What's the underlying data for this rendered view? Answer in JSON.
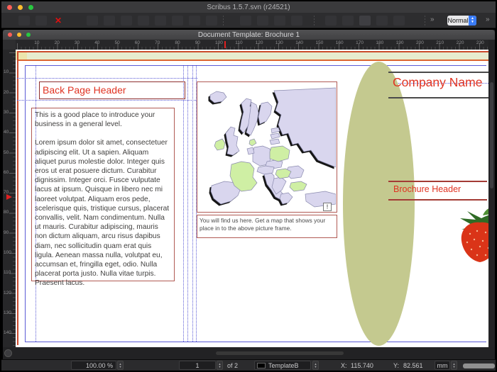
{
  "app": {
    "title": "Scribus 1.5.7.svn (r24521)"
  },
  "toolbar": {
    "close_glyph": "✕",
    "overflow_left": "»",
    "overflow_right": "»",
    "view_mode": "Normal"
  },
  "doc_window": {
    "title": "Document Template: Brochure 1"
  },
  "rulers": {
    "h_numbers": [
      "10",
      "20",
      "30",
      "40",
      "50",
      "60",
      "70",
      "80",
      "90",
      "100",
      "110",
      "120",
      "130",
      "140",
      "150",
      "160",
      "170",
      "180",
      "190",
      "200",
      "210",
      "220",
      "230"
    ],
    "v_numbers": [
      "10",
      "20",
      "30",
      "40",
      "50",
      "60",
      "70",
      "80",
      "90",
      "100",
      "110",
      "120",
      "130",
      "140"
    ]
  },
  "page": {
    "back_page_header": "Back Page Header",
    "body_paragraphs": [
      "This is a good place to introduce your business in a general level.",
      "Lorem ipsum dolor sit amet, consectetuer adipiscing elit. Ut a sapien. Aliquam aliquet purus molestie dolor. Integer quis eros ut erat posuere dictum. Curabitur dignissim. Integer orci. Fusce vulputate lacus at ipsum. Quisque in libero nec mi laoreet volutpat. Aliquam eros pede, scelerisque quis, tristique cursus, placerat convallis, velit. Nam condimentum. Nulla ut mauris. Curabitur adipiscing, mauris non dictum aliquam, arcu risus dapibus diam, nec sollicitudin quam erat quis ligula. Aenean massa nulla, volutpat eu, accumsan et, fringilla eget, odio. Nulla placerat porta justo. Nulla vitae turpis. Praesent lacus."
    ],
    "map_caption": "You will find us here. Get a map that shows your place in to the above picture frame.",
    "image_warning_glyph": "!",
    "company_name": "Company Name",
    "brochure_header": "Brochure Header"
  },
  "statusbar": {
    "zoom": "100.00 %",
    "page_current": "1",
    "page_total_label": "of 2",
    "layer": "TemplateB",
    "x_label": "X:",
    "x_value": "115.740",
    "y_label": "Y:",
    "y_value": "82.561",
    "unit": "mm"
  },
  "colors": {
    "red_heading": "#e03322",
    "frame_border": "#b15a54",
    "guide_blue": "#5c5cd6",
    "page_border_red": "#cc4a2c",
    "surfboard_green": "#c4c98f",
    "map_country": "#d9d6ee",
    "map_highlight": "#cfefa4",
    "strawberry_red": "#da3418",
    "combo_blue": "#3a7cf7"
  }
}
